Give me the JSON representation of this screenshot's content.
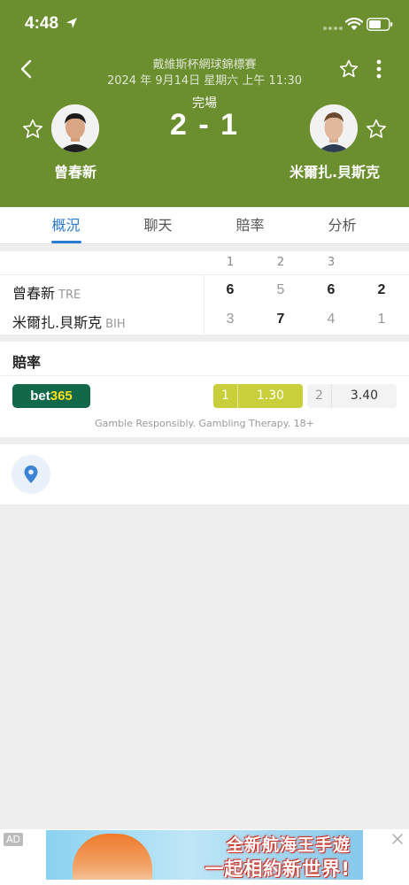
{
  "status_bar": {
    "time": "4:48"
  },
  "header": {
    "tournament": "戴維斯杯網球錦標賽",
    "datetime": "2024 年 9月14日 星期六 上午 11:30",
    "match_status": "完場",
    "score": "2 - 1",
    "home": {
      "name": "曾春新"
    },
    "away": {
      "name": "米爾扎.貝斯克"
    }
  },
  "tabs": [
    {
      "label": "概況",
      "active": true
    },
    {
      "label": "聊天",
      "active": false
    },
    {
      "label": "賠率",
      "active": false
    },
    {
      "label": "分析",
      "active": false
    }
  ],
  "scoreboard": {
    "set_headers": [
      "1",
      "2",
      "3"
    ],
    "rows": [
      {
        "name": "曾春新",
        "code": "TRE",
        "sets": [
          "6",
          "5",
          "6"
        ],
        "total": "2"
      },
      {
        "name": "米爾扎.貝斯克",
        "code": "BIH",
        "sets": [
          "3",
          "7",
          "4"
        ],
        "total": "1"
      }
    ]
  },
  "odds": {
    "title": "賠率",
    "bookmaker": {
      "part1": "bet",
      "part2": "365"
    },
    "home_label": "1",
    "home_value": "1.30",
    "away_label": "2",
    "away_value": "3.40",
    "disclaimer": "Gamble Responsibly. Gambling Therapy. 18+"
  },
  "ad": {
    "label": "AD",
    "line1": "全新航海王手遊",
    "line2": "一起相約新世界!"
  },
  "colors": {
    "header_green": "#6b8e2f",
    "accent_blue": "#2a7ad2",
    "odds_highlight": "#c8cf3a",
    "bet365_green": "#11694a"
  },
  "icons": [
    "location-arrow-icon",
    "signal-icon",
    "wifi-icon",
    "battery-icon",
    "back-icon",
    "star-icon",
    "more-icon",
    "map-pin-icon",
    "close-icon"
  ]
}
